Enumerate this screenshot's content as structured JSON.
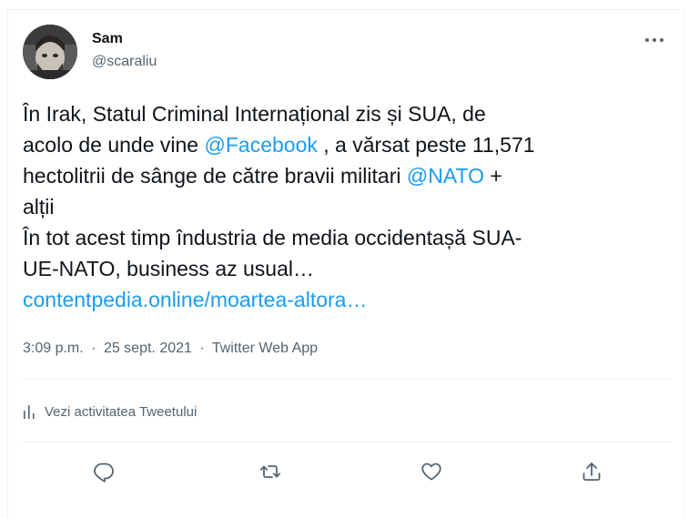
{
  "user": {
    "name": "Sam",
    "handle": "@scaraliu"
  },
  "tweet": {
    "line1": "În Irak, Statul Criminal Internațional zis și SUA, de",
    "line2_pre": "acolo de unde vine ",
    "mention_facebook": "@Facebook",
    "line2_post": " , a vărsat peste 11,571",
    "line3_pre": "hectolitrii de sânge de către bravii militari ",
    "mention_nato": "@NATO",
    "line3_post": " +",
    "line4": "alții",
    "line5": "În tot acest timp îndustria de media occidentașă SUA-",
    "line6": "UE-NATO, business az usual…",
    "link": "contentpedia.online/moartea-altora…"
  },
  "meta": {
    "time": "3:09 p.m.",
    "separator1": "·",
    "date": "25 sept. 2021",
    "separator2": "·",
    "source": "Twitter Web App"
  },
  "activity": {
    "label": "Vezi activitatea Tweetului"
  },
  "colors": {
    "text": "#0f1419",
    "secondary": "#536471",
    "link": "#1d9bf0",
    "border": "#eff3f4"
  },
  "icons": {
    "more": "more-horizontal-icon",
    "activity": "bar-chart-icon",
    "reply": "reply-icon",
    "retweet": "retweet-icon",
    "like": "heart-icon",
    "share": "share-icon"
  }
}
